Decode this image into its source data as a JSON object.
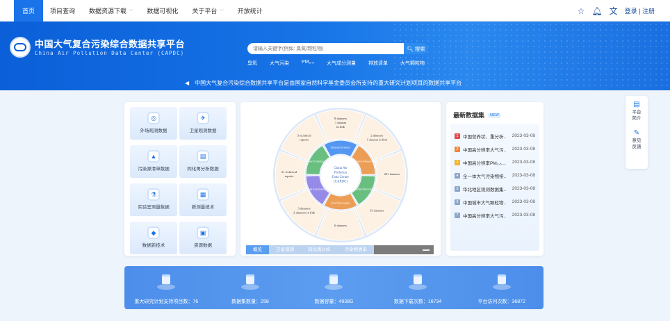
{
  "nav": {
    "items": [
      {
        "label": "首页",
        "active": true
      },
      {
        "label": "项目查询"
      },
      {
        "label": "数据资源下载",
        "caret": true
      },
      {
        "label": "数据可视化"
      },
      {
        "label": "关于平台",
        "caret": true
      },
      {
        "label": "开放统计"
      }
    ],
    "auth": "登录 | 注册"
  },
  "banner": {
    "title": "中国大气复合污染综合数据共享平台",
    "subtitle": "China Air Pollution Data Center (CAPDC)",
    "search_placeholder": "请输入关键字(例如: 臭氧/颗粒物)",
    "search_button": "搜索",
    "hot_words": [
      "臭氧",
      "大气污染",
      "PM₂.₅",
      "大气成分测量",
      "排放清单",
      "大气颗粒物"
    ],
    "notice": "中国大气复合污染综合数据共享平台是由国家自然科学基金委员会所支持的重大研究计划项目的数据共享平台"
  },
  "tiles": [
    {
      "label": "外场观测数据",
      "icon": "◎"
    },
    {
      "label": "卫星观测数据",
      "icon": "✈"
    },
    {
      "label": "污染源清单数据",
      "icon": "▲"
    },
    {
      "label": "同化再分析数据",
      "icon": "▤"
    },
    {
      "label": "实验室测量数据",
      "icon": "⚗"
    },
    {
      "label": "新测量技术",
      "icon": "▦"
    },
    {
      "label": "数据新技术",
      "icon": "◆"
    },
    {
      "label": "资源数据",
      "icon": "▣"
    }
  ],
  "diagram": {
    "center": [
      "China Air",
      "Pollution",
      "Data Center",
      "(CAPDC)"
    ],
    "inner": [
      "Emission Inventory",
      "Laboratory Measurements",
      "Satellite Observations",
      "Field Observations",
      "Data Assimilation",
      "New Technology"
    ],
    "outer_labels": [
      {
        "lines": [
          "8 datasets",
          "1 dataset",
          "in link"
        ]
      },
      {
        "lines": [
          "2 datasets",
          "1 dataset in link"
        ]
      },
      {
        "lines": [
          "221 datasets"
        ]
      },
      {
        "lines": [
          "33 datasets"
        ]
      },
      {
        "lines": [
          "6 datasets"
        ]
      },
      {
        "lines": [
          "3 datasets",
          "2 datasets in link"
        ]
      },
      {
        "lines": [
          "21 technical",
          "reports"
        ]
      },
      {
        "lines": [
          "3 technical",
          "reports"
        ]
      }
    ],
    "tabs": [
      "概览",
      "卫星观测",
      "同化再分析",
      "污染物清单"
    ]
  },
  "latest": {
    "title": "最新数据集",
    "badge": "NEW",
    "items": [
      {
        "num": "1",
        "title": "中国营养状、重分析…",
        "date": "2023-03-08",
        "color": "#e8484a"
      },
      {
        "num": "2",
        "title": "中国高分辨率大气污…",
        "date": "2023-03-08",
        "color": "#f0853a"
      },
      {
        "num": "3",
        "title": "中国高分辨率PM₂.₅…",
        "date": "2023-03-08",
        "color": "#f0b429"
      },
      {
        "num": "4",
        "title": "全一体大气污染物排…",
        "date": "2023-03-08",
        "color": "#8aa6c9"
      },
      {
        "num": "5",
        "title": "华北地区观测数据集…",
        "date": "2023-03-08",
        "color": "#8aa6c9"
      },
      {
        "num": "6",
        "title": "中国城市大气颗粒物…",
        "date": "2023-03-08",
        "color": "#8aa6c9"
      },
      {
        "num": "7",
        "title": "中国高分辨率大气污…",
        "date": "2023-03-08",
        "color": "#8aa6c9"
      }
    ]
  },
  "side": [
    {
      "label1": "平台",
      "label2": "简介",
      "icon": "▤"
    },
    {
      "label1": "意见",
      "label2": "反馈",
      "icon": "✎"
    }
  ],
  "stats": [
    {
      "label": "重大研究计划支持项目数：76"
    },
    {
      "label": "数据集数量：258"
    },
    {
      "label": "数据容量：4938G"
    },
    {
      "label": "数据下载次数：16734"
    },
    {
      "label": "平台访问次数：36872"
    }
  ]
}
